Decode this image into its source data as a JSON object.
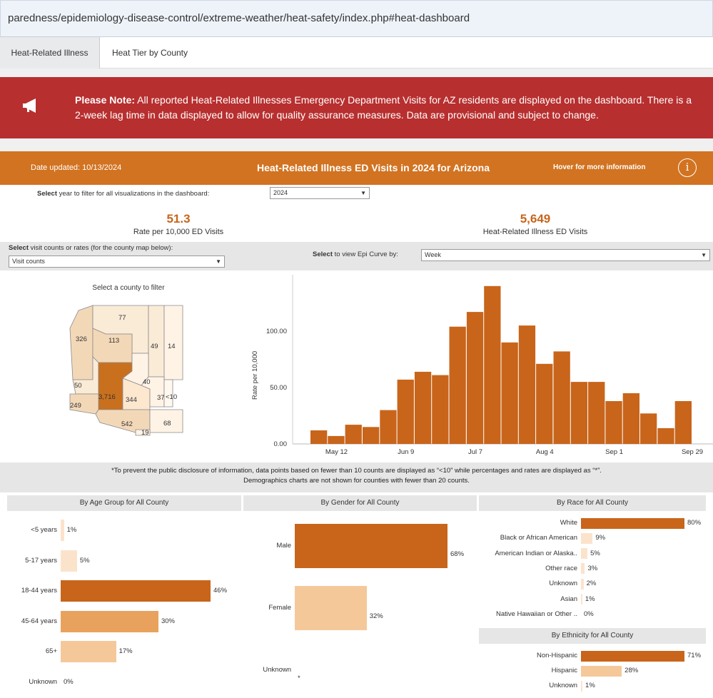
{
  "url": "paredness/epidemiology-disease-control/extreme-weather/heat-safety/index.php#heat-dashboard",
  "tabs": [
    {
      "label": "Heat-Related Illness",
      "active": true
    },
    {
      "label": "Heat Tier by County",
      "active": false
    }
  ],
  "alert": {
    "bold": "Please Note:",
    "text": " All reported Heat-Related Illnesses Emergency Department Visits for AZ residents are displayed on the dashboard. There is a 2-week lag time in data displayed to allow for quality assurance measures. Data are provisional and subject to change.",
    "icon": "megaphone-icon",
    "color": "#b82f2f"
  },
  "header": {
    "date_updated": "Date updated: 10/13/2024",
    "title": "Heat-Related Illness ED Visits in 2024 for Arizona",
    "hover": "Hover for more information",
    "info_icon": "i",
    "color": "#d27321"
  },
  "filters": {
    "year_label_bold": "Select",
    "year_label": " year to filter for all visualizations in the dashboard:",
    "year_value": "2024",
    "visit_label_bold": "Select",
    "visit_label": " visit counts or rates (for the county map below):",
    "visit_value": "Visit counts",
    "epi_label_bold": "Select",
    "epi_label": " to view Epi Curve by:",
    "epi_value": "Week"
  },
  "kpis": [
    {
      "value": "51.3",
      "label": "Rate per 10,000 ED Visits"
    },
    {
      "value": "5,649",
      "label": "Heat-Related Illness ED Visits"
    }
  ],
  "map": {
    "title": "Select a county to filter",
    "counties": [
      {
        "name": "Mohave",
        "value": "326"
      },
      {
        "name": "Coconino",
        "value": "77"
      },
      {
        "name": "Navajo",
        "value": "49"
      },
      {
        "name": "Apache",
        "value": "14"
      },
      {
        "name": "Yavapai",
        "value": "113"
      },
      {
        "name": "La Paz",
        "value": "50"
      },
      {
        "name": "Maricopa",
        "value": "3,716"
      },
      {
        "name": "Gila",
        "value": "40"
      },
      {
        "name": "Yuma",
        "value": "249"
      },
      {
        "name": "Pinal",
        "value": "344"
      },
      {
        "name": "Graham",
        "value": "37"
      },
      {
        "name": "Greenlee",
        "value": "<10"
      },
      {
        "name": "Pima",
        "value": "542"
      },
      {
        "name": "Cochise",
        "value": "68"
      },
      {
        "name": "Santa Cruz",
        "value": "19"
      }
    ]
  },
  "chart_data": {
    "type": "bar",
    "ylabel": "Rate per 10,000",
    "ylim": [
      0,
      150
    ],
    "yticks": [
      "0.00",
      "50.00",
      "100.00"
    ],
    "xticks": [
      "May 12",
      "Jun 9",
      "Jul 7",
      "Aug 4",
      "Sep 1",
      "Sep 29"
    ],
    "values": [
      12,
      7,
      17,
      15,
      30,
      57,
      64,
      61,
      104,
      117,
      140,
      90,
      105,
      71,
      82,
      55,
      55,
      38,
      45,
      27,
      14,
      38
    ],
    "color": "#c8651b"
  },
  "notes": {
    "line1": "*To prevent the public disclosure of information, data points based on fewer than 10 counts are displayed as “<10” while percentages and rates are displayed as “*”.",
    "line2": "Demographics charts are not shown for counties with fewer than 20 counts."
  },
  "age": {
    "title": "By Age Group for All County",
    "rows": [
      {
        "label": "<5 years",
        "pct": "1%",
        "value": 1
      },
      {
        "label": "5-17 years",
        "pct": "5%",
        "value": 5
      },
      {
        "label": "18-44 years",
        "pct": "46%",
        "value": 46
      },
      {
        "label": "45-64 years",
        "pct": "30%",
        "value": 30
      },
      {
        "label": "65+",
        "pct": "17%",
        "value": 17
      },
      {
        "label": "Unknown",
        "pct": "0%",
        "value": 0
      }
    ]
  },
  "gender": {
    "title": "By Gender for All County",
    "rows": [
      {
        "label": "Male",
        "pct": "68%",
        "value": 68
      },
      {
        "label": "Female",
        "pct": "32%",
        "value": 32
      },
      {
        "label": "Unknown",
        "pct": "*",
        "value": 0
      }
    ]
  },
  "race": {
    "title": "By Race for All County",
    "rows": [
      {
        "label": "White",
        "pct": "80%",
        "value": 80
      },
      {
        "label": "Black or African American",
        "pct": "9%",
        "value": 9
      },
      {
        "label": "American Indian or Alaska..",
        "pct": "5%",
        "value": 5
      },
      {
        "label": "Other race",
        "pct": "3%",
        "value": 3
      },
      {
        "label": "Unknown",
        "pct": "2%",
        "value": 2
      },
      {
        "label": "Asian",
        "pct": "1%",
        "value": 1
      },
      {
        "label": "Native Hawaiian or Other ..",
        "pct": "0%",
        "value": 0
      }
    ]
  },
  "ethnicity": {
    "title": "By Ethnicity for All County",
    "rows": [
      {
        "label": "Non-Hispanic",
        "pct": "71%",
        "value": 71
      },
      {
        "label": "Hispanic",
        "pct": "28%",
        "value": 28
      },
      {
        "label": "Unknown",
        "pct": "1%",
        "value": 1
      }
    ]
  }
}
